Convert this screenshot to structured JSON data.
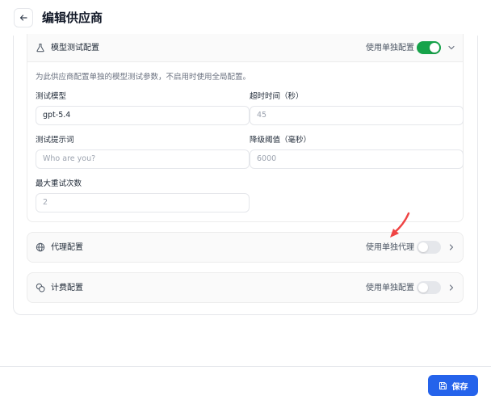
{
  "header": {
    "title": "编辑供应商"
  },
  "test_config": {
    "title": "模型测试配置",
    "toggle_label": "使用单独配置",
    "toggle_on": true,
    "description": "为此供应商配置单独的模型测试参数，不启用时使用全局配置。",
    "fields": {
      "model": {
        "label": "测试模型",
        "value": "gpt-5.4"
      },
      "timeout": {
        "label": "超时时间（秒）",
        "placeholder": "45"
      },
      "prompt": {
        "label": "测试提示词",
        "placeholder": "Who are you?"
      },
      "degrade": {
        "label": "降级阈值（毫秒）",
        "placeholder": "6000"
      },
      "retries": {
        "label": "最大重试次数",
        "placeholder": "2"
      }
    }
  },
  "proxy_config": {
    "title": "代理配置",
    "toggle_label": "使用单独代理",
    "toggle_on": false
  },
  "billing_config": {
    "title": "计费配置",
    "toggle_label": "使用单独配置",
    "toggle_on": false
  },
  "footer": {
    "save_label": "保存"
  },
  "colors": {
    "accent": "#2563eb",
    "toggle_on": "#16a34a",
    "annotation": "#ef4444"
  }
}
